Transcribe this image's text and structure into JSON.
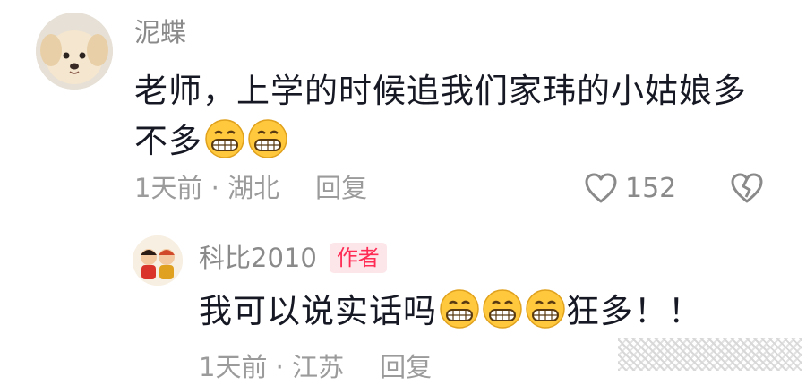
{
  "main_comment": {
    "username": "泥蝶",
    "text": "老师，上学的时候追我们家玮的小姑娘多不多",
    "emoji_count": 2,
    "time": "1天前",
    "separator": "·",
    "location": "湖北",
    "reply_label": "回复",
    "like_count": "152"
  },
  "reply_comment": {
    "username": "科比2010",
    "badge": "作者",
    "text_before": "我可以说实话吗",
    "emoji_count": 3,
    "text_after": "狂多！！",
    "time": "1天前",
    "separator": "·",
    "location": "江苏",
    "reply_label": "回复"
  },
  "icons": {
    "like": "heart-outline-icon",
    "dislike": "broken-heart-icon",
    "emoji": "grin-emoji-icon"
  },
  "colors": {
    "badge_text": "#fe2c55",
    "badge_bg": "#fde6e9",
    "meta_gray": "#9b9b9b",
    "emoji_yellow": "#ffc83d"
  }
}
